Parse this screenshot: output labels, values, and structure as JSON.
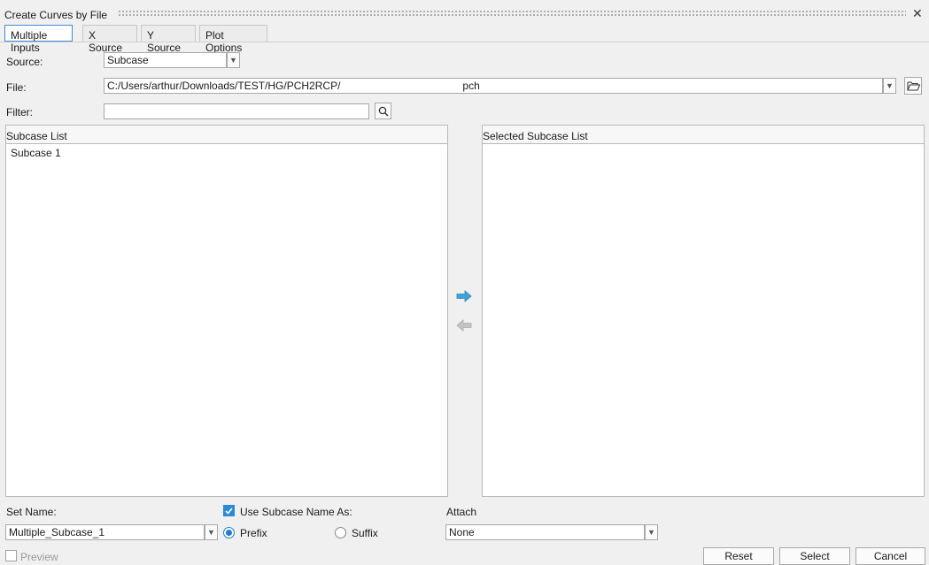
{
  "window": {
    "title": "Create Curves by File"
  },
  "tabs": [
    {
      "label": "Multiple Inputs"
    },
    {
      "label": "X Source"
    },
    {
      "label": "Y Source"
    },
    {
      "label": "Plot Options"
    }
  ],
  "source": {
    "label": "Source:",
    "value": "Subcase"
  },
  "file": {
    "label": "File:",
    "path_prefix": "C:/Users/arthur/Downloads/TEST/HG/PCH2RCP/",
    "path_suffix": "pch"
  },
  "filter": {
    "label": "Filter:",
    "value": ""
  },
  "subcase_list": {
    "header": "Subcase List",
    "items": [
      "Subcase 1"
    ]
  },
  "selected_list": {
    "header": "Selected Subcase List",
    "items": []
  },
  "set_name": {
    "label": "Set Name:",
    "value": "Multiple_Subcase_1"
  },
  "use_subcase_name": {
    "label": "Use Subcase Name As:",
    "checked": true
  },
  "naming": {
    "prefix_label": "Prefix",
    "suffix_label": "Suffix",
    "selected": "Prefix"
  },
  "attach": {
    "label": "Attach",
    "value": "None"
  },
  "preview": {
    "label": "Preview",
    "checked": false
  },
  "buttons": {
    "reset": "Reset",
    "select": "Select",
    "cancel": "Cancel"
  },
  "colors": {
    "accent": "#2a8ad8",
    "arrow_active": "#3fa3d8",
    "arrow_inactive": "#b0b0b0"
  },
  "icons": {
    "close": "close-icon",
    "dropdown": "chevron-down-icon",
    "open_folder": "folder-open-icon",
    "search": "search-icon",
    "add": "arrow-right-icon",
    "remove": "arrow-left-icon"
  }
}
